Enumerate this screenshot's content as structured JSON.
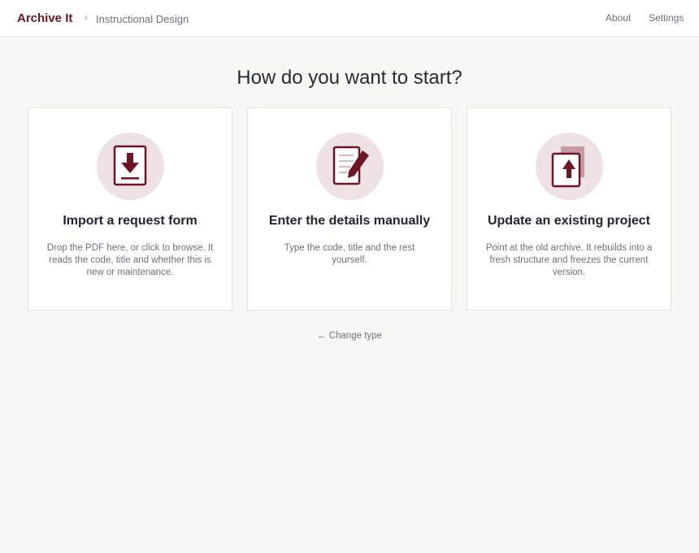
{
  "header": {
    "brand": "Archive It",
    "breadcrumb_separator": "›",
    "breadcrumb": "Instructional Design",
    "nav": {
      "about": "About",
      "settings": "Settings"
    }
  },
  "main": {
    "heading": "How do you want to start?",
    "options": [
      {
        "icon": "import-document-icon",
        "title": "Import a request form",
        "description": "Drop the PDF here, or click to browse. It reads the code, title and whether this is new or maintenance."
      },
      {
        "icon": "edit-document-icon",
        "title": "Enter the details manually",
        "description": "Type the code, title and the rest yourself."
      },
      {
        "icon": "upload-document-icon",
        "title": "Update an existing project",
        "description": "Point at the old archive. It rebuilds into a fresh structure and freezes the current version."
      }
    ],
    "change_type": "← Change type"
  },
  "colors": {
    "brand": "#6e1423",
    "icon_circle": "#eee2e4",
    "background": "#f8f7f4"
  }
}
